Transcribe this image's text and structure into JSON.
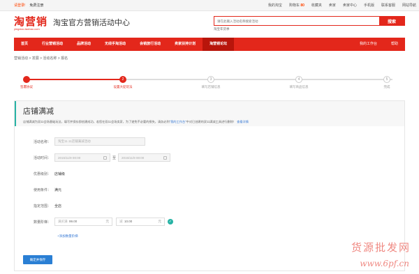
{
  "topbar": {
    "login": "请登录!",
    "register": "免费注册",
    "my_page": "我的淘宝",
    "cart": "购物车",
    "cart_count": "80",
    "favorites": "收藏夹",
    "sellers": "卖家",
    "seller_center": "卖家中心",
    "mobile": "手机版",
    "contact": "联系客服",
    "site_nav": "网站导航"
  },
  "header": {
    "brand": "淘营销",
    "domain": "yingxiao.taobao.com",
    "title": "淘宝官方营销活动中心",
    "search_placeholder": "请在此输入活动名称搜索活动",
    "search_button": "搜索",
    "search_hint": "淘宝年货季"
  },
  "nav": {
    "items": [
      {
        "label": "首页",
        "active": false
      },
      {
        "label": "行业营销活动",
        "active": false
      },
      {
        "label": "品牌活动",
        "active": false
      },
      {
        "label": "无线手淘活动",
        "active": false
      },
      {
        "label": "会销旅行活动",
        "active": false
      },
      {
        "label": "卖家扶持计划",
        "active": false
      },
      {
        "label": "淘营销论坛",
        "active": true
      }
    ],
    "workbench": "我的工作台",
    "help": "帮助"
  },
  "breadcrumb": "营销活动 > 发展 > 活动名称 > 报名",
  "steps": [
    {
      "num": "1",
      "label": "签署协议",
      "state": "done"
    },
    {
      "num": "2",
      "label": "设置大促玩法",
      "state": "current"
    },
    {
      "num": "3",
      "label": "填写店铺信息",
      "state": "todo"
    },
    {
      "num": "4",
      "label": "填写商品信息",
      "state": "todo"
    },
    {
      "num": "5",
      "label": "完成",
      "state": "todo"
    }
  ],
  "panel": {
    "title": "店铺满减",
    "desc": "店铺满减为双11会场基础玩法，填写并保存即创建成功，若您在双11会场卖家，为了避免不必要的损失，请务必到",
    "desc_link": "\"我的工作台\"",
    "desc_tail": "中对已创建的双11满减工具进行删除！",
    "desc_detail": "查看详情"
  },
  "form": {
    "name_label": "活动名称：",
    "name_value": "淘宝11.11店铺满减活动",
    "time_label": "活动时间：",
    "time_start": "2015/11/9  00:00",
    "time_sep": "至",
    "time_end": "2015/11/9  00:00",
    "level_label": "优惠级别：",
    "level_value": "店铺级",
    "condition_label": "使用条件：",
    "condition_value": "满元",
    "scope_label": "指定范围：",
    "scope_value": "全店",
    "tier_label": "数量阶梯：",
    "tier_full_prefix": "满买满",
    "tier_full_value": "99.00",
    "tier_full_unit": "元",
    "tier_minus_prefix": "减",
    "tier_minus_value": "10.00",
    "tier_minus_unit": "元",
    "add_tier": "+添加数量阶梯",
    "submit": "确定并保存"
  },
  "watermark": {
    "text": "货源批发网",
    "url": "www.6pf.cn"
  }
}
